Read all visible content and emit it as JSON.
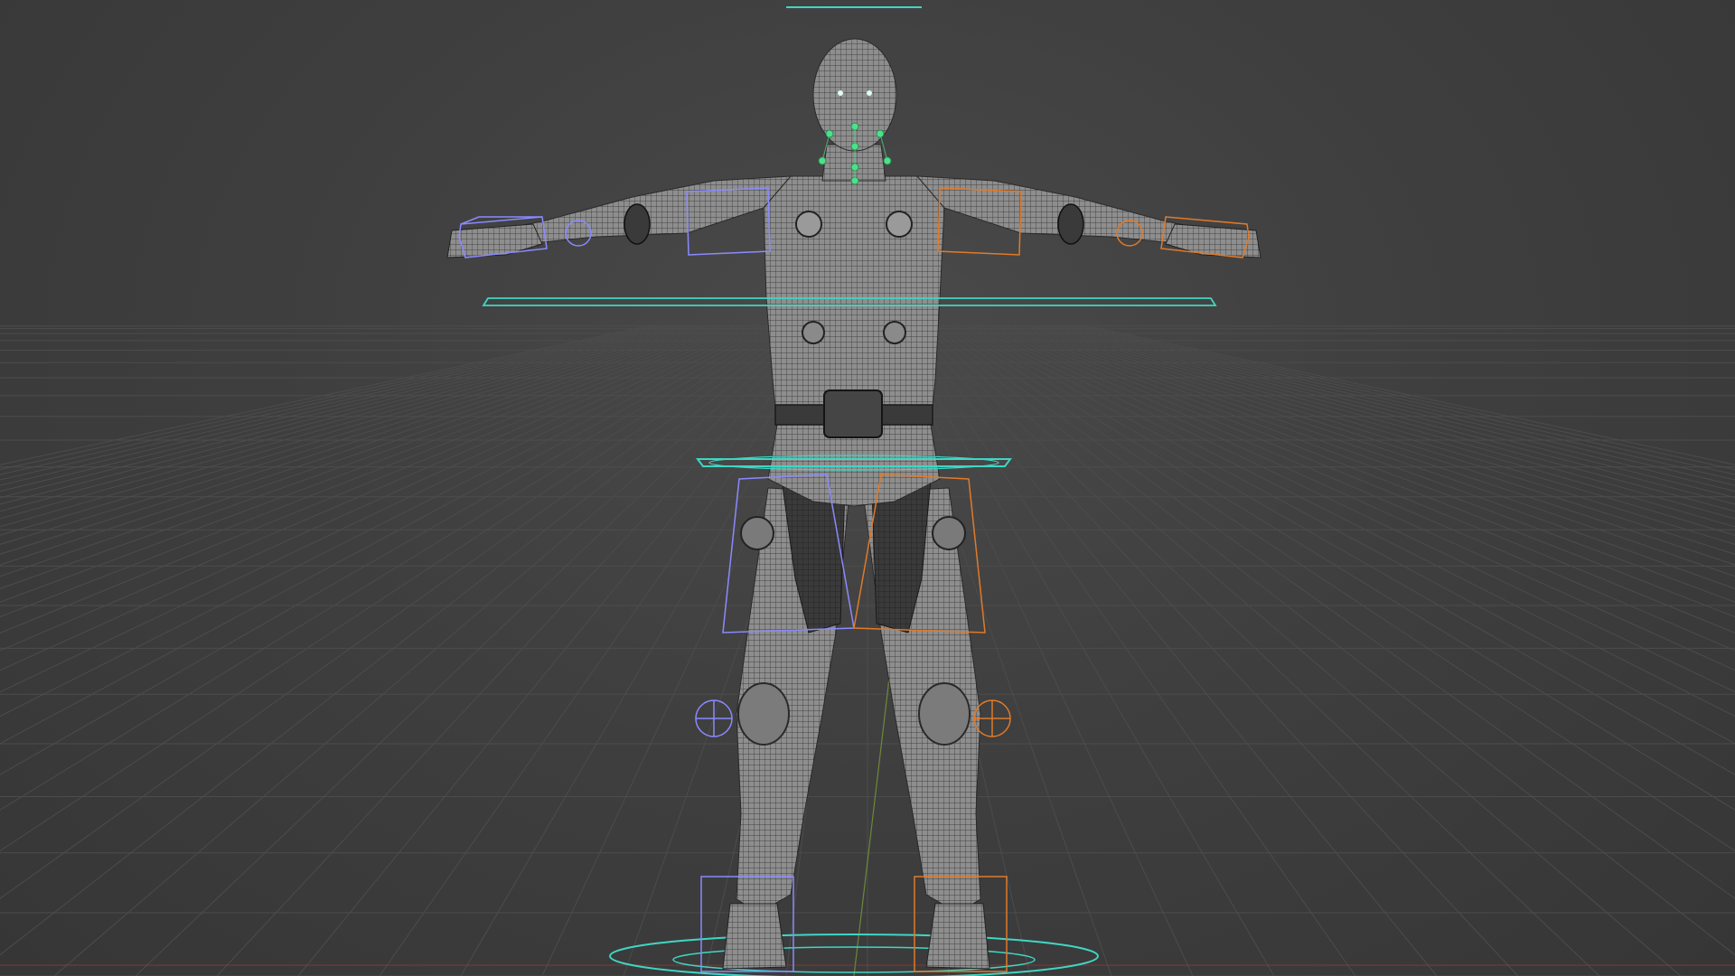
{
  "viewport": {
    "background": "#3d3d3d",
    "grid_color": "#4c4c4c"
  },
  "rig": {
    "mesh_color": "#8a8a8a",
    "wire_color": "#2a2a2a",
    "left_side_color": "#8a8aff",
    "right_side_color": "#e07a2a",
    "center_color": "#3fd6c4",
    "face_control_color": "#4ee08a"
  }
}
